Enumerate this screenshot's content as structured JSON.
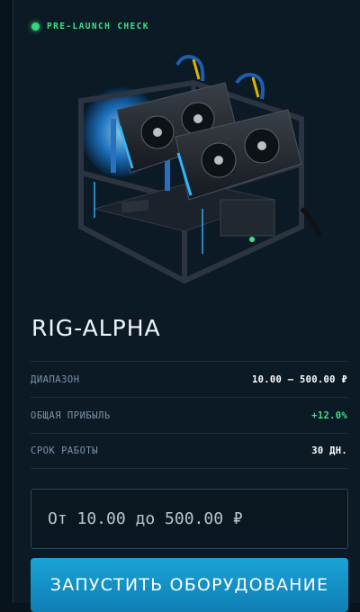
{
  "status": {
    "label": "PRE-LAUNCH CHECK",
    "color": "#37d67a"
  },
  "rig": {
    "name": "RIG-ALPHA",
    "image_icon": "gpu-mining-rig-icon"
  },
  "specs": [
    {
      "label": "ДИАПАЗОН",
      "value": "10.00 — 500.00 ₽",
      "highlight": false
    },
    {
      "label": "ОБЩАЯ ПРИБЫЛЬ",
      "value": "+12.0%",
      "highlight": true
    },
    {
      "label": "СРОК РАБОТЫ",
      "value": "30 ДН.",
      "highlight": false
    }
  ],
  "amount_input": {
    "placeholder": "От 10.00 до 500.00 ₽",
    "value": ""
  },
  "launch_button": {
    "label": "ЗАПУСТИТЬ ОБОРУДОВАНИЕ",
    "color": "#1aa3d8"
  },
  "colors": {
    "accent_green": "#3fe08a",
    "accent_blue": "#1aa3d8",
    "background": "#0b1a25"
  }
}
